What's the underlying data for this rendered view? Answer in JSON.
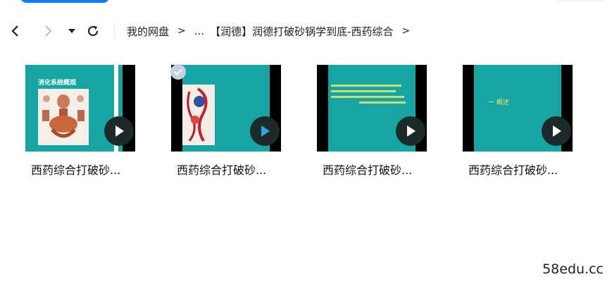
{
  "breadcrumb": {
    "root": "我的网盘",
    "sep1": ">",
    "ellipsis": "...",
    "current": "【润德】润德打破砂锅学到底-西药综合",
    "sep2": ">"
  },
  "files": [
    {
      "name": "西药综合打破砂...",
      "slide_title": "消化系统概观",
      "selected": false
    },
    {
      "name": "西药综合打破砂...",
      "selected": true
    },
    {
      "name": "西药综合打破砂...",
      "selected": false
    },
    {
      "name": "西药综合打破砂...",
      "slide_text": "一 概述",
      "selected": false
    }
  ],
  "watermark": "58edu.cc",
  "colors": {
    "accent": "#0a7cff",
    "thumb_bg": "#17a5a3",
    "play_selected": "#2aa8e6"
  }
}
